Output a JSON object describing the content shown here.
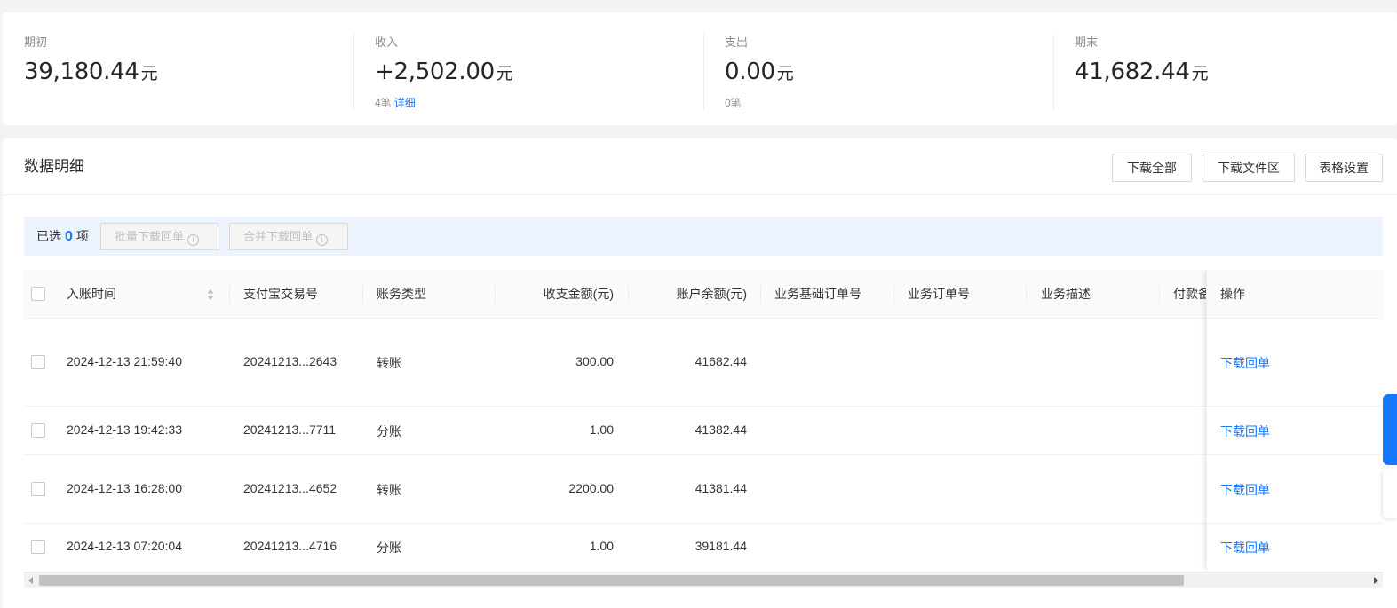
{
  "summary": {
    "opening": {
      "label": "期初",
      "amount": "39,180.44",
      "unit": "元"
    },
    "income": {
      "label": "收入",
      "amount": "+2,502.00",
      "unit": "元",
      "count": "4笔",
      "detail_link": "详细"
    },
    "expense": {
      "label": "支出",
      "amount": "0.00",
      "unit": "元",
      "count": "0笔"
    },
    "closing": {
      "label": "期末",
      "amount": "41,682.44",
      "unit": "元"
    }
  },
  "detail": {
    "title": "数据明细",
    "buttons": {
      "download_all": "下载全部",
      "download_files": "下载文件区",
      "table_settings": "表格设置"
    }
  },
  "selection": {
    "prefix": "已选",
    "count": "0",
    "suffix": "项",
    "batch_download": "批量下载回单",
    "merge_download": "合并下载回单"
  },
  "table": {
    "columns": {
      "time": "入账时间",
      "trade_no": "支付宝交易号",
      "type": "账务类型",
      "amount": "收支金额(元)",
      "balance": "账户余额(元)",
      "base_order": "业务基础订单号",
      "order": "业务订单号",
      "desc": "业务描述",
      "remark": "付款备",
      "action": "操作"
    },
    "rows": [
      {
        "time": "2024-12-13 21:59:40",
        "trade_no": "20241213...2643",
        "type": "转账",
        "amount": "300.00",
        "balance": "41682.44",
        "action": "下载回单"
      },
      {
        "time": "2024-12-13 19:42:33",
        "trade_no": "20241213...7711",
        "type": "分账",
        "amount": "1.00",
        "balance": "41382.44",
        "action": "下载回单"
      },
      {
        "time": "2024-12-13 16:28:00",
        "trade_no": "20241213...4652",
        "type": "转账",
        "amount": "2200.00",
        "balance": "41381.44",
        "action": "下载回单"
      },
      {
        "time": "2024-12-13 07:20:04",
        "trade_no": "20241213...4716",
        "type": "分账",
        "amount": "1.00",
        "balance": "39181.44",
        "action": "下载回单"
      }
    ]
  },
  "icons": {
    "sort": "sort-icon",
    "info": "info-icon"
  },
  "colors": {
    "accent": "#1677ff",
    "selection_bg": "#edf3fd"
  }
}
